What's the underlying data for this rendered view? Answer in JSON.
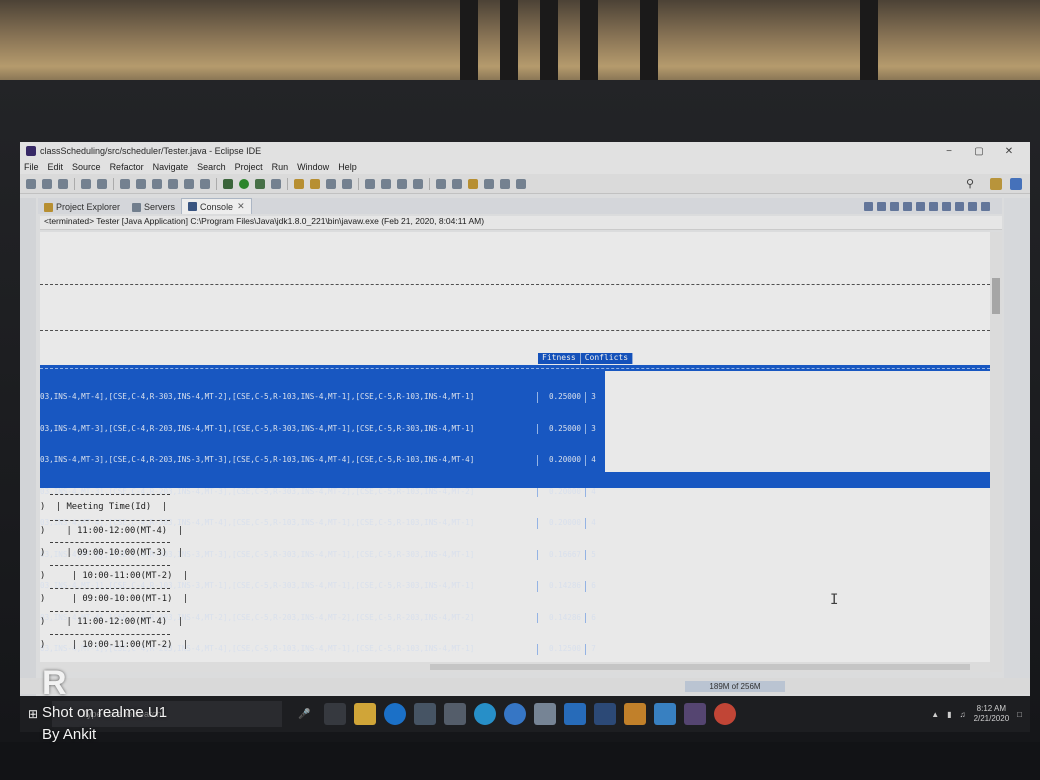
{
  "window": {
    "title": "classScheduling/src/scheduler/Tester.java - Eclipse IDE",
    "min": "−",
    "max": "▢",
    "close": "✕"
  },
  "menu": [
    "File",
    "Edit",
    "Source",
    "Refactor",
    "Navigate",
    "Search",
    "Project",
    "Run",
    "Window",
    "Help"
  ],
  "tabs": {
    "project_explorer": "Project Explorer",
    "servers": "Servers",
    "console": "Console"
  },
  "console": {
    "terminated_line": "<terminated> Tester [Java Application] C:\\Program Files\\Java\\jdk1.8.0_221\\bin\\javaw.exe (Feb 21, 2020, 8:04:11 AM)",
    "header_fitness": "Fitness",
    "header_conflicts": "Conflicts",
    "rows": [
      {
        "schedule": "03,INS-4,MT-4],[CSE,C-4,R-303,INS-4,MT-2],[CSE,C-5,R-103,INS-4,MT-1],[CSE,C-5,R-103,INS-4,MT-1]",
        "fitness": "0.25000",
        "conflicts": "3"
      },
      {
        "schedule": "03,INS-4,MT-3],[CSE,C-4,R-203,INS-4,MT-1],[CSE,C-5,R-303,INS-4,MT-1],[CSE,C-5,R-303,INS-4,MT-1]",
        "fitness": "0.25000",
        "conflicts": "3"
      },
      {
        "schedule": "03,INS-4,MT-3],[CSE,C-4,R-203,INS-3,MT-3],[CSE,C-5,R-103,INS-4,MT-4],[CSE,C-5,R-103,INS-4,MT-4]",
        "fitness": "0.20000",
        "conflicts": "4"
      },
      {
        "schedule": "03,INS-4,MT-3],[CSE,C-4,R-203,INS-4,MT-3],[CSE,C-5,R-303,INS-4,MT-2],[CSE,C-5,R-103,INS-4,MT-2]",
        "fitness": "0.20000",
        "conflicts": "4"
      },
      {
        "schedule": "03,INS-4,MT-4],[CSE,C-4,R-303,INS-4,MT-4],[CSE,C-5,R-103,INS-4,MT-1],[CSE,C-5,R-103,INS-4,MT-1]",
        "fitness": "0.20000",
        "conflicts": "4"
      },
      {
        "schedule": "03,INS-4,MT-3],[CSE,C-4,R-303,INS-3,MT-3],[CSE,C-5,R-303,INS-4,MT-1],[CSE,C-5,R-303,INS-4,MT-1]",
        "fitness": "0.16667",
        "conflicts": "5"
      },
      {
        "schedule": "03,INS-4,MT-1],[CSE,C-4,R-103,INS-3,MT-1],[CSE,C-5,R-303,INS-4,MT-1],[CSE,C-5,R-303,INS-4,MT-1]",
        "fitness": "0.14286",
        "conflicts": "6"
      },
      {
        "schedule": "03,INS-4,MT-4],[CSE,C-4,R-303,INS-4,MT-2],[CSE,C-5,R-203,INS-4,MT-2],[CSE,C-5,R-203,INS-4,MT-2]",
        "fitness": "0.14286",
        "conflicts": "6"
      },
      {
        "schedule": "03,INS-4,MT-1],[CSE,C-4,R-203,INS-4,MT-4],[CSE,C-5,R-103,INS-4,MT-1],[CSE,C-5,R-103,INS-4,MT-1]",
        "fitness": "0.12500",
        "conflicts": "7"
      }
    ],
    "meeting_header": ")  | Meeting Time(Id)  |",
    "meeting_rows": [
      ")    | 11:00-12:00(MT-4)  |",
      ")    | 09:00-10:00(MT-3)  |",
      ")     | 10:00-11:00(MT-2)  |",
      ")     | 09:00-10:00(MT-1)  |",
      ")    | 11:00-12:00(MT-4)  |",
      ")     | 10:00-11:00(MT-2)  |"
    ]
  },
  "statusbar": {
    "heap": "189M of 256M"
  },
  "taskbar": {
    "search_placeholder": "Type here to search",
    "time": "8:12 AM",
    "date": "2/21/2020"
  },
  "watermark": {
    "logo": "R",
    "line1": "Shot on realme U1",
    "line2": "By Ankit"
  }
}
